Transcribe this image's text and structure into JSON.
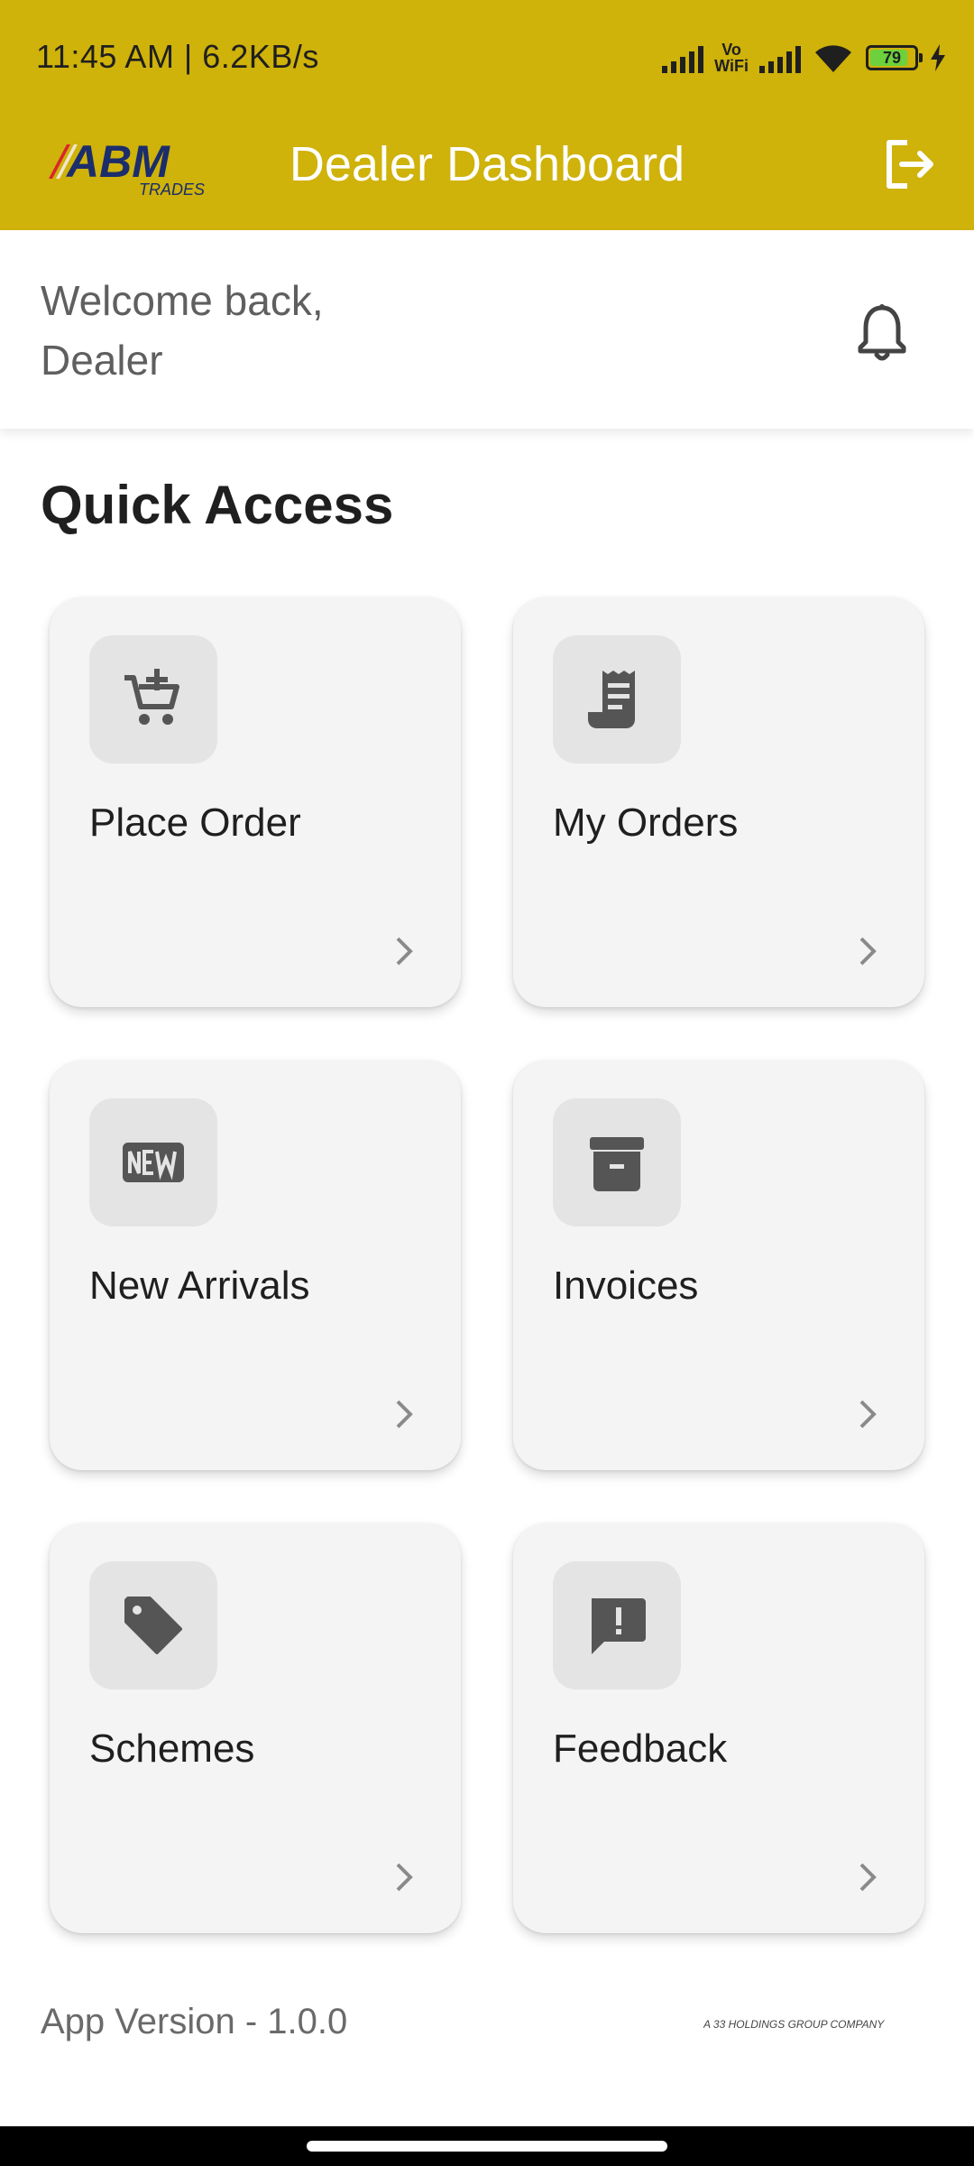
{
  "status_bar": {
    "time_speed": "11:45 AM | 6.2KB/s",
    "vowifi_top": "Vo",
    "vowifi_bottom": "WiFi",
    "battery": "79"
  },
  "app_bar": {
    "logo_text": "ABM",
    "logo_sub": "TRADES",
    "title": "Dealer Dashboard"
  },
  "welcome": {
    "text": "Welcome back,\nDealer"
  },
  "quick_access": {
    "title": "Quick Access",
    "cards": [
      {
        "label": "Place Order",
        "icon": "cart-add-icon"
      },
      {
        "label": "My Orders",
        "icon": "receipt-icon"
      },
      {
        "label": "New Arrivals",
        "icon": "new-badge-icon"
      },
      {
        "label": "Invoices",
        "icon": "archive-box-icon"
      },
      {
        "label": "Schemes",
        "icon": "tag-icon"
      },
      {
        "label": "Feedback",
        "icon": "feedback-icon"
      }
    ]
  },
  "footer": {
    "version": "App Version - 1.0.0",
    "brand_text": "A 33 HOLDINGS GROUP COMPANY"
  },
  "colors": {
    "app_bar": "#cfb20a",
    "card_bg": "#f4f4f4",
    "icon_box": "#e4e4e4",
    "icon": "#555555"
  }
}
